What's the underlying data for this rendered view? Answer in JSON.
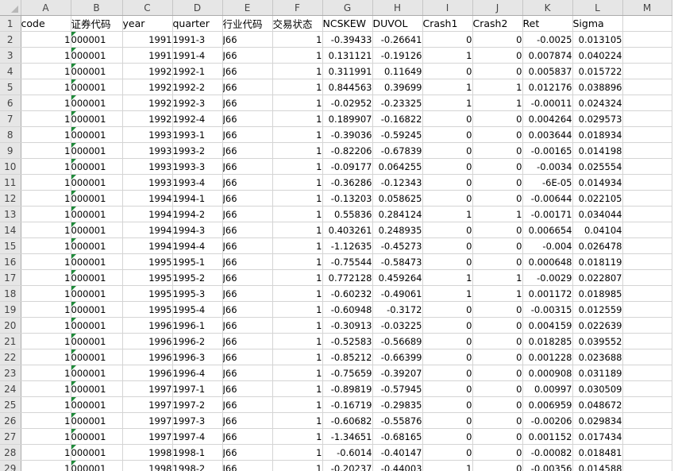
{
  "sheet": {
    "columns": [
      "A",
      "B",
      "C",
      "D",
      "E",
      "F",
      "G",
      "H",
      "I",
      "J",
      "K",
      "L",
      "M"
    ],
    "header_row": {
      "row_label": "1",
      "cells": [
        "code",
        "证券代码",
        "year",
        "quarter",
        "行业代码",
        "交易状态",
        "NCSKEW",
        "DUVOL",
        "Crash1",
        "Crash2",
        "Ret",
        "Sigma",
        ""
      ]
    },
    "rows": [
      {
        "row_label": "2",
        "cells": [
          "1",
          "000001",
          "1991",
          "1991-3",
          "J66",
          "1",
          "-0.39433",
          "-0.26641",
          "0",
          "0",
          "-0.0025",
          "0.013105",
          ""
        ]
      },
      {
        "row_label": "3",
        "cells": [
          "1",
          "000001",
          "1991",
          "1991-4",
          "J66",
          "1",
          "0.131121",
          "-0.19126",
          "1",
          "0",
          "0.007874",
          "0.040224",
          ""
        ]
      },
      {
        "row_label": "4",
        "cells": [
          "1",
          "000001",
          "1992",
          "1992-1",
          "J66",
          "1",
          "0.311991",
          "0.11649",
          "0",
          "0",
          "0.005837",
          "0.015722",
          ""
        ]
      },
      {
        "row_label": "5",
        "cells": [
          "1",
          "000001",
          "1992",
          "1992-2",
          "J66",
          "1",
          "0.844563",
          "0.39699",
          "1",
          "1",
          "0.012176",
          "0.038896",
          ""
        ]
      },
      {
        "row_label": "6",
        "cells": [
          "1",
          "000001",
          "1992",
          "1992-3",
          "J66",
          "1",
          "-0.02952",
          "-0.23325",
          "1",
          "1",
          "-0.00011",
          "0.024324",
          ""
        ]
      },
      {
        "row_label": "7",
        "cells": [
          "1",
          "000001",
          "1992",
          "1992-4",
          "J66",
          "1",
          "0.189907",
          "-0.16822",
          "0",
          "0",
          "0.004264",
          "0.029573",
          ""
        ]
      },
      {
        "row_label": "8",
        "cells": [
          "1",
          "000001",
          "1993",
          "1993-1",
          "J66",
          "1",
          "-0.39036",
          "-0.59245",
          "0",
          "0",
          "0.003644",
          "0.018934",
          ""
        ]
      },
      {
        "row_label": "9",
        "cells": [
          "1",
          "000001",
          "1993",
          "1993-2",
          "J66",
          "1",
          "-0.82206",
          "-0.67839",
          "0",
          "0",
          "-0.00165",
          "0.014198",
          ""
        ]
      },
      {
        "row_label": "10",
        "cells": [
          "1",
          "000001",
          "1993",
          "1993-3",
          "J66",
          "1",
          "-0.09177",
          "0.064255",
          "0",
          "0",
          "-0.0034",
          "0.025554",
          ""
        ]
      },
      {
        "row_label": "11",
        "cells": [
          "1",
          "000001",
          "1993",
          "1993-4",
          "J66",
          "1",
          "-0.36286",
          "-0.12343",
          "0",
          "0",
          "-6E-05",
          "0.014934",
          ""
        ]
      },
      {
        "row_label": "12",
        "cells": [
          "1",
          "000001",
          "1994",
          "1994-1",
          "J66",
          "1",
          "-0.13203",
          "0.058625",
          "0",
          "0",
          "-0.00644",
          "0.022105",
          ""
        ]
      },
      {
        "row_label": "13",
        "cells": [
          "1",
          "000001",
          "1994",
          "1994-2",
          "J66",
          "1",
          "0.55836",
          "0.284124",
          "1",
          "1",
          "-0.00171",
          "0.034044",
          ""
        ]
      },
      {
        "row_label": "14",
        "cells": [
          "1",
          "000001",
          "1994",
          "1994-3",
          "J66",
          "1",
          "0.403261",
          "0.248935",
          "0",
          "0",
          "0.006654",
          "0.04104",
          ""
        ]
      },
      {
        "row_label": "15",
        "cells": [
          "1",
          "000001",
          "1994",
          "1994-4",
          "J66",
          "1",
          "-1.12635",
          "-0.45273",
          "0",
          "0",
          "-0.004",
          "0.026478",
          ""
        ]
      },
      {
        "row_label": "16",
        "cells": [
          "1",
          "000001",
          "1995",
          "1995-1",
          "J66",
          "1",
          "-0.75544",
          "-0.58473",
          "0",
          "0",
          "0.000648",
          "0.018119",
          ""
        ]
      },
      {
        "row_label": "17",
        "cells": [
          "1",
          "000001",
          "1995",
          "1995-2",
          "J66",
          "1",
          "0.772128",
          "0.459264",
          "1",
          "1",
          "-0.0029",
          "0.022807",
          ""
        ]
      },
      {
        "row_label": "18",
        "cells": [
          "1",
          "000001",
          "1995",
          "1995-3",
          "J66",
          "1",
          "-0.60232",
          "-0.49061",
          "1",
          "1",
          "0.001172",
          "0.018985",
          ""
        ]
      },
      {
        "row_label": "19",
        "cells": [
          "1",
          "000001",
          "1995",
          "1995-4",
          "J66",
          "1",
          "-0.60948",
          "-0.3172",
          "0",
          "0",
          "-0.00315",
          "0.012559",
          ""
        ]
      },
      {
        "row_label": "20",
        "cells": [
          "1",
          "000001",
          "1996",
          "1996-1",
          "J66",
          "1",
          "-0.30913",
          "-0.03225",
          "0",
          "0",
          "0.004159",
          "0.022639",
          ""
        ]
      },
      {
        "row_label": "21",
        "cells": [
          "1",
          "000001",
          "1996",
          "1996-2",
          "J66",
          "1",
          "-0.52583",
          "-0.56689",
          "0",
          "0",
          "0.018285",
          "0.039552",
          ""
        ]
      },
      {
        "row_label": "22",
        "cells": [
          "1",
          "000001",
          "1996",
          "1996-3",
          "J66",
          "1",
          "-0.85212",
          "-0.66399",
          "0",
          "0",
          "0.001228",
          "0.023688",
          ""
        ]
      },
      {
        "row_label": "23",
        "cells": [
          "1",
          "000001",
          "1996",
          "1996-4",
          "J66",
          "1",
          "-0.75659",
          "-0.39207",
          "0",
          "0",
          "0.000908",
          "0.031189",
          ""
        ]
      },
      {
        "row_label": "24",
        "cells": [
          "1",
          "000001",
          "1997",
          "1997-1",
          "J66",
          "1",
          "-0.89819",
          "-0.57945",
          "0",
          "0",
          "0.00997",
          "0.030509",
          ""
        ]
      },
      {
        "row_label": "25",
        "cells": [
          "1",
          "000001",
          "1997",
          "1997-2",
          "J66",
          "1",
          "-0.16719",
          "-0.29835",
          "0",
          "0",
          "0.006959",
          "0.048672",
          ""
        ]
      },
      {
        "row_label": "26",
        "cells": [
          "1",
          "000001",
          "1997",
          "1997-3",
          "J66",
          "1",
          "-0.60682",
          "-0.55876",
          "0",
          "0",
          "-0.00206",
          "0.029834",
          ""
        ]
      },
      {
        "row_label": "27",
        "cells": [
          "1",
          "000001",
          "1997",
          "1997-4",
          "J66",
          "1",
          "-1.34651",
          "-0.68165",
          "0",
          "0",
          "0.001152",
          "0.017434",
          ""
        ]
      },
      {
        "row_label": "28",
        "cells": [
          "1",
          "000001",
          "1998",
          "1998-1",
          "J66",
          "1",
          "-0.6014",
          "-0.40147",
          "0",
          "0",
          "-0.00082",
          "0.018481",
          ""
        ]
      },
      {
        "row_label": "29",
        "cells": [
          "1",
          "000001",
          "1998",
          "1998-2",
          "J66",
          "1",
          "-0.20237",
          "-0.44003",
          "1",
          "0",
          "-0.00356",
          "0.014588",
          ""
        ]
      }
    ]
  }
}
